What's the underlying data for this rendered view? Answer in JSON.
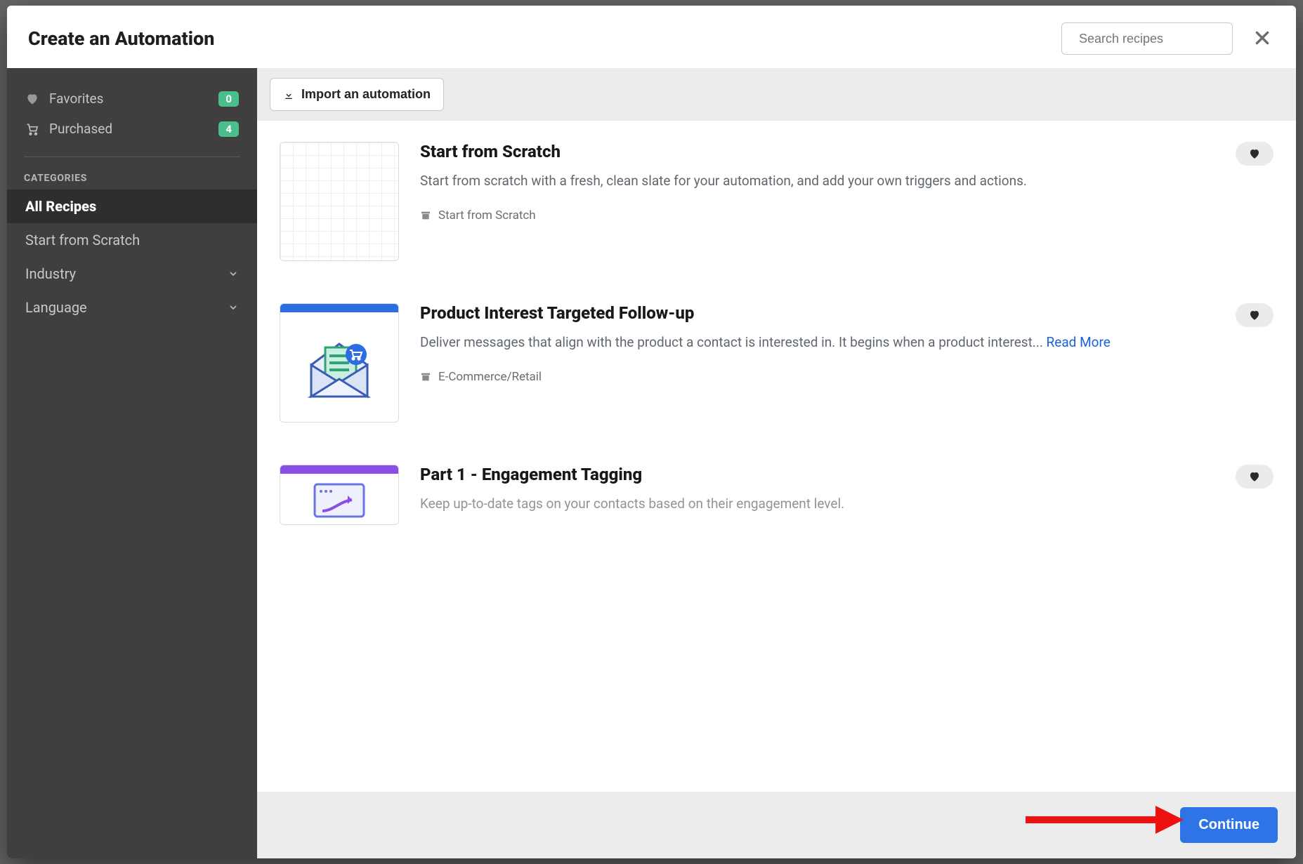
{
  "header": {
    "title": "Create an Automation",
    "search_placeholder": "Search recipes"
  },
  "sidebar": {
    "favorites_label": "Favorites",
    "favorites_count": "0",
    "purchased_label": "Purchased",
    "purchased_count": "4",
    "categories_heading": "CATEGORIES",
    "categories": [
      {
        "label": "All Recipes",
        "active": true,
        "expandable": false
      },
      {
        "label": "Start from Scratch",
        "active": false,
        "expandable": false
      },
      {
        "label": "Industry",
        "active": false,
        "expandable": true
      },
      {
        "label": "Language",
        "active": false,
        "expandable": true
      }
    ]
  },
  "toolbar": {
    "import_label": "Import an automation"
  },
  "recipes": [
    {
      "title": "Start from Scratch",
      "description": "Start from scratch with a fresh, clean slate for your automation, and add your own triggers and actions.",
      "read_more": "",
      "category": "Start from Scratch",
      "thumb": "grid"
    },
    {
      "title": "Product Interest Targeted Follow-up",
      "description": "Deliver messages that align with the product a contact is interested in. It begins when a product interest... ",
      "read_more": "Read More",
      "category": "E-Commerce/Retail",
      "thumb": "envelope"
    },
    {
      "title": "Part 1 - Engagement Tagging",
      "description": "Keep up-to-date tags on your contacts based on their engagement level.",
      "read_more": "",
      "category": "",
      "thumb": "tag"
    }
  ],
  "footer": {
    "continue_label": "Continue"
  }
}
